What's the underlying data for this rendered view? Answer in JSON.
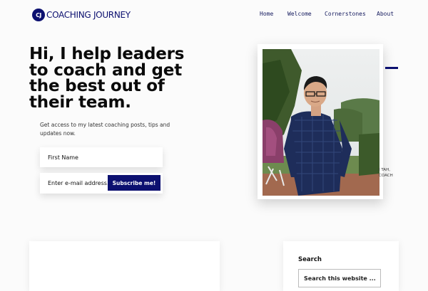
{
  "logo": {
    "mark": "CJ",
    "text": "COACHING JOURNEY"
  },
  "nav": {
    "items": [
      "Home",
      "Welcome",
      "Cornerstones",
      "About"
    ]
  },
  "hero": {
    "title": "Hi, I help leaders to coach and get the best out of their team.",
    "subtitle": "Get access to my latest coaching posts, tips and updates now."
  },
  "form": {
    "first_name_placeholder": "First Name",
    "email_placeholder": "Enter e-mail address...",
    "subscribe_label": "Subscribe me!"
  },
  "side_text": {
    "line1": "I TAH,",
    "line2": "COACH"
  },
  "sidebar": {
    "search_title": "Search",
    "search_placeholder": "Search this website ..."
  },
  "colors": {
    "brand": "#0c1070"
  }
}
